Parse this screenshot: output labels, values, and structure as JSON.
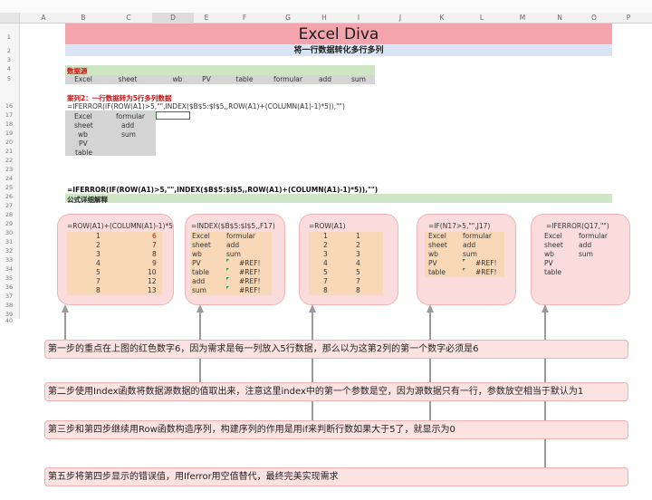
{
  "top_hint": "",
  "columns": [
    "A",
    "B",
    "C",
    "D",
    "E",
    "F",
    "G",
    "H",
    "I",
    "J",
    "K",
    "L",
    "M",
    "N",
    "O",
    "P"
  ],
  "rows": [
    "1",
    "2",
    "3",
    "4",
    "5",
    "16",
    "17",
    "18",
    "19",
    "20",
    "21",
    "22",
    "23",
    "24",
    "25",
    "26",
    "27",
    "28",
    "29",
    "30",
    "31",
    "32",
    "33",
    "34",
    "35",
    "36",
    "37",
    "38",
    "39",
    "40"
  ],
  "title": "Excel Diva",
  "subtitle": "将一行数据转化多行多列",
  "source_label": "数据源",
  "source_values": [
    "Excel",
    "sheet",
    "wb",
    "PV",
    "table",
    "formular",
    "add",
    "sum"
  ],
  "case_label": "案列2：一行数据转为5行多列数据",
  "formula_small": "=IFERROR(IF(ROW(A1)>5,\"\",INDEX($B$5:$I$5,,ROW(A1)+(COLUMN(A1)-1)*5)),\"\")",
  "result_col1": [
    "Excel",
    "sheet",
    "wb",
    "PV",
    "table"
  ],
  "result_col2": [
    "formular",
    "add",
    "sum"
  ],
  "formula_big": "=IFERROR(IF(ROW(A1)>5,\"\",INDEX($B$5:$I$5,,ROW(A1)+(COLUMN(A1)-1)*5)),\"\")",
  "explain_label": "公式详细解释",
  "panels": [
    {
      "header": "=ROW(A1)+(COLUMN(A1)-1)*5",
      "col1": [
        "1",
        "2",
        "3",
        "4",
        "5",
        "7",
        "8"
      ],
      "col2": [
        "6",
        "7",
        "8",
        "9",
        "10",
        "12",
        "13"
      ]
    },
    {
      "header": "=INDEX($B$5:$I$5,,F17)",
      "col1": [
        "Excel",
        "sheet",
        "wb",
        "PV",
        "table",
        "add",
        "sum"
      ],
      "col2": [
        "formular",
        "add",
        "sum",
        "#REF!",
        "#REF!",
        "#REF!",
        "#REF!"
      ]
    },
    {
      "header": "=ROW(A1)",
      "col1": [
        "1",
        "2",
        "3",
        "4",
        "5",
        "7",
        "8"
      ],
      "col2": [
        "1",
        "2",
        "3",
        "4",
        "5",
        "7",
        "8"
      ]
    },
    {
      "header": "=IF(N17>5,\"\",J17)",
      "col1": [
        "Excel",
        "sheet",
        "wb",
        "PV",
        "table"
      ],
      "col2": [
        "formular",
        "add",
        "sum",
        "#REF!",
        "#REF!"
      ]
    },
    {
      "header": "=IFERROR(Q17,\"\")",
      "col1": [
        "Excel",
        "sheet",
        "wb",
        "PV",
        "table"
      ],
      "col2": [
        "formular",
        "add",
        "sum"
      ]
    }
  ],
  "notes": [
    "第一步的重点在上图的红色数字6，因为需求是每一列放入5行数据，那么以为这第2列的第一个数字必须是6",
    "第二步使用Index函数将数据源数据的值取出来，注意这里index中的第一个参数是空，因为源数据只有一行，参数放空相当于默认为1",
    "第三步和第四步继续用Row函数构造序列，构建序列的作用是用if来判断行数如果大于5了，就显示为0",
    "第五步将第四步显示的错误值，用Iferror用空值替代，最终完美实现需求"
  ],
  "colors": {
    "title_bg": "#f4a4ad",
    "subtitle_bg": "#d9e4f4",
    "green": "#cfe6c4",
    "panel_bg": "#fbdcdc",
    "table_bg": "#f9d8b8",
    "red": "#d01010"
  }
}
